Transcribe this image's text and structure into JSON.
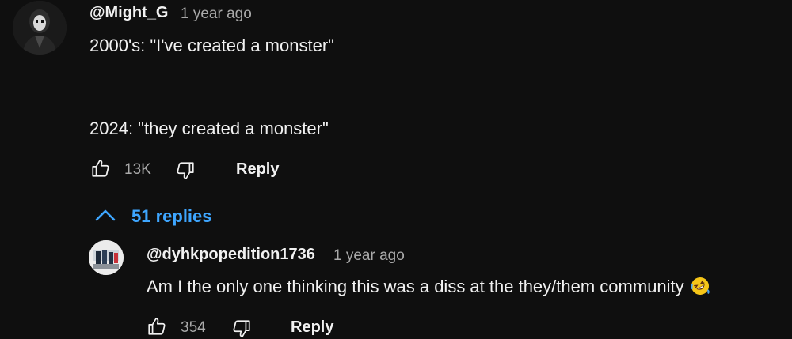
{
  "comment": {
    "author": "@Might_G",
    "time": "1 year ago",
    "line1": "2000's: \"I've created a monster\"",
    "line2": "2024: \"they created a monster\"",
    "likes": "13K",
    "reply_label": "Reply"
  },
  "replies_toggle": {
    "label": "51 replies"
  },
  "reply": {
    "author": "@dyhkpopedition1736",
    "time": "1 year ago",
    "text": "Am I the only one thinking this was a diss at the they/them community",
    "likes": "354",
    "reply_label": "Reply"
  },
  "icons": {
    "like": "thumbs-up-icon",
    "dislike": "thumbs-down-icon",
    "collapse": "chevron-up-icon",
    "emoji": "rolling-on-floor-laughing-emoji"
  },
  "colors": {
    "background": "#0f0f0f",
    "primary_text": "#f1f1f1",
    "secondary_text": "#aaaaaa",
    "link_blue": "#3ea6ff"
  }
}
